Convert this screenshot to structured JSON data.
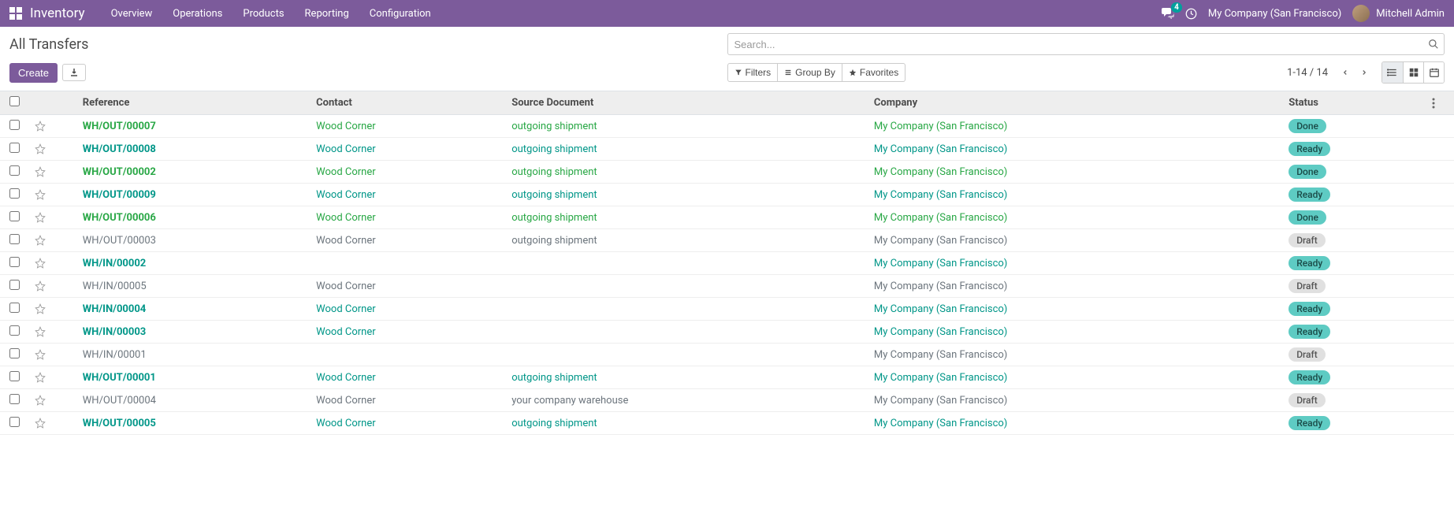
{
  "navbar": {
    "app_name": "Inventory",
    "menu": [
      "Overview",
      "Operations",
      "Products",
      "Reporting",
      "Configuration"
    ],
    "chat_count": "4",
    "company": "My Company (San Francisco)",
    "user": "Mitchell Admin"
  },
  "breadcrumb": "All Transfers",
  "search": {
    "placeholder": "Search..."
  },
  "buttons": {
    "create": "Create",
    "filters": "Filters",
    "group_by": "Group By",
    "favorites": "Favorites"
  },
  "pager": "1-14 / 14",
  "columns": {
    "reference": "Reference",
    "contact": "Contact",
    "source": "Source Document",
    "company": "Company",
    "status": "Status"
  },
  "rows": [
    {
      "ref": "WH/OUT/00007",
      "contact": "Wood Corner",
      "source": "outgoing shipment",
      "company": "My Company (San Francisco)",
      "status": "Done",
      "style": "green"
    },
    {
      "ref": "WH/OUT/00008",
      "contact": "Wood Corner",
      "source": "outgoing shipment",
      "company": "My Company (San Francisco)",
      "status": "Ready",
      "style": "teal"
    },
    {
      "ref": "WH/OUT/00002",
      "contact": "Wood Corner",
      "source": "outgoing shipment",
      "company": "My Company (San Francisco)",
      "status": "Done",
      "style": "green"
    },
    {
      "ref": "WH/OUT/00009",
      "contact": "Wood Corner",
      "source": "outgoing shipment",
      "company": "My Company (San Francisco)",
      "status": "Ready",
      "style": "teal"
    },
    {
      "ref": "WH/OUT/00006",
      "contact": "Wood Corner",
      "source": "outgoing shipment",
      "company": "My Company (San Francisco)",
      "status": "Done",
      "style": "green"
    },
    {
      "ref": "WH/OUT/00003",
      "contact": "Wood Corner",
      "source": "outgoing shipment",
      "company": "My Company (San Francisco)",
      "status": "Draft",
      "style": "muted"
    },
    {
      "ref": "WH/IN/00002",
      "contact": "",
      "source": "",
      "company": "My Company (San Francisco)",
      "status": "Ready",
      "style": "teal"
    },
    {
      "ref": "WH/IN/00005",
      "contact": "Wood Corner",
      "source": "",
      "company": "My Company (San Francisco)",
      "status": "Draft",
      "style": "muted"
    },
    {
      "ref": "WH/IN/00004",
      "contact": "Wood Corner",
      "source": "",
      "company": "My Company (San Francisco)",
      "status": "Ready",
      "style": "teal"
    },
    {
      "ref": "WH/IN/00003",
      "contact": "Wood Corner",
      "source": "",
      "company": "My Company (San Francisco)",
      "status": "Ready",
      "style": "teal"
    },
    {
      "ref": "WH/IN/00001",
      "contact": "",
      "source": "",
      "company": "My Company (San Francisco)",
      "status": "Draft",
      "style": "muted"
    },
    {
      "ref": "WH/OUT/00001",
      "contact": "Wood Corner",
      "source": "outgoing shipment",
      "company": "My Company (San Francisco)",
      "status": "Ready",
      "style": "teal"
    },
    {
      "ref": "WH/OUT/00004",
      "contact": "Wood Corner",
      "source": "your company warehouse",
      "company": "My Company (San Francisco)",
      "status": "Draft",
      "style": "muted"
    },
    {
      "ref": "WH/OUT/00005",
      "contact": "Wood Corner",
      "source": "outgoing shipment",
      "company": "My Company (San Francisco)",
      "status": "Ready",
      "style": "teal"
    }
  ],
  "status_classes": {
    "Done": "badge-done",
    "Ready": "badge-ready",
    "Draft": "badge-draft"
  }
}
